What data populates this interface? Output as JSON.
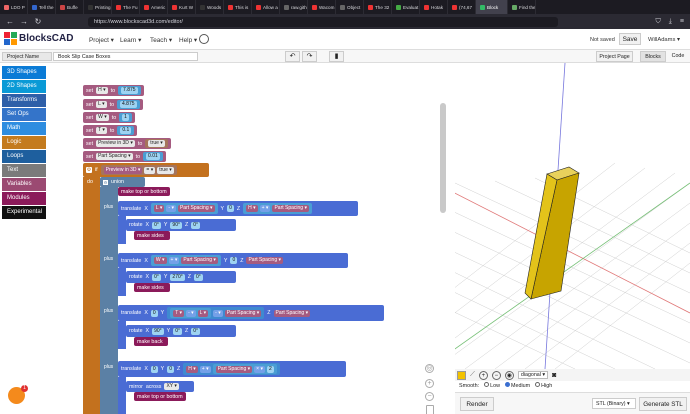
{
  "browser": {
    "tabs": [
      {
        "label": "LDO P",
        "color": "#e66"
      },
      {
        "label": "Tell the",
        "color": "#36c"
      },
      {
        "label": "Buffe",
        "color": "#c44"
      },
      {
        "label": "Printing",
        "color": "#333"
      },
      {
        "label": "The Fu",
        "color": "#e33"
      },
      {
        "label": "Americ",
        "color": "#e33"
      },
      {
        "label": "Kurt W",
        "color": "#e33"
      },
      {
        "label": "Woods",
        "color": "#333"
      },
      {
        "label": "This is",
        "color": "#e33"
      },
      {
        "label": "Allow a",
        "color": "#e33"
      },
      {
        "label": "raw.githubus",
        "color": "#666"
      },
      {
        "label": "Wacom",
        "color": "#e33"
      },
      {
        "label": "Object",
        "color": "#666"
      },
      {
        "label": "The 32",
        "color": "#e33"
      },
      {
        "label": "Evaluat",
        "color": "#4a4"
      },
      {
        "label": "Hotak",
        "color": "#e33"
      },
      {
        "label": "(74,67",
        "color": "#e33"
      },
      {
        "label": "Block",
        "color": "#3b6"
      },
      {
        "label": "Find the",
        "color": "#6a6"
      }
    ],
    "url": "https://www.blockscad3d.com/editor/",
    "nav_back": "←",
    "nav_forward": "→",
    "nav_reload": "↻"
  },
  "app": {
    "logo": "BlocksCAD",
    "menus": [
      "Project",
      "Learn",
      "Teach",
      "Help"
    ],
    "status": "Not saved",
    "save_label": "Save",
    "user": "WillAdams"
  },
  "project": {
    "name_label": "Project Name",
    "name_value": "Book Slip Case Boxes",
    "project_page": "Project Page",
    "blocks": "Blocks",
    "code": "Code"
  },
  "toolbox": [
    {
      "label": "3D Shapes",
      "color": "#0a7bd6"
    },
    {
      "label": "2D Shapes",
      "color": "#0a9ad6"
    },
    {
      "label": "Transforms",
      "color": "#2e5fa8"
    },
    {
      "label": "Set Ops",
      "color": "#3474c9"
    },
    {
      "label": "Math",
      "color": "#2e8de0"
    },
    {
      "label": "Logic",
      "color": "#c47b1e"
    },
    {
      "label": "Loops",
      "color": "#1e5f9e"
    },
    {
      "label": "Text",
      "color": "#7b7b7b"
    },
    {
      "label": "Variables",
      "color": "#9b4a72"
    },
    {
      "label": "Modules",
      "color": "#8b1a5a"
    },
    {
      "label": "Experimental",
      "color": "#111111"
    }
  ],
  "blocks": {
    "set_vars": [
      {
        "kw": "set",
        "var": "H",
        "to": "to",
        "val": "7.875"
      },
      {
        "kw": "set",
        "var": "L",
        "to": "to",
        "val": "4.875"
      },
      {
        "kw": "set",
        "var": "W",
        "to": "to",
        "val": "1"
      },
      {
        "kw": "set",
        "var": "T",
        "to": "to",
        "val": "0.1"
      },
      {
        "kw": "set",
        "var": "Preview in 3D",
        "to": "to",
        "val": "true"
      },
      {
        "kw": "set",
        "var": "Part Spacing",
        "to": "to",
        "val": "0.01"
      }
    ],
    "if_kw": "if",
    "do_kw": "do",
    "cond_var": "Preview in 3D",
    "cond_op": "=",
    "cond_val": "true",
    "union": "union",
    "plus": "plus",
    "make_top": "make top or bottom",
    "make_sides": "make sides",
    "make_back": "make back",
    "translate": "translate",
    "rotate": "rotate",
    "mirror": "mirror",
    "across": "across",
    "mirror_plane": "XY",
    "x": "X",
    "y": "Y",
    "z": "Z",
    "zero": "0",
    "minus": "-",
    "plus_op": "+",
    "times": "×",
    "H": "H",
    "L": "L",
    "W": "W",
    "T": "T",
    "part_spacing": "Part Spacing",
    "ninety": "90",
    "two_seventy": "270",
    "two": "2"
  },
  "viewer": {
    "view_option": "diagonal",
    "smooth_label": "Smooth:",
    "smooth_options": [
      "Low",
      "Medium",
      "High"
    ],
    "smooth_selected": "Medium",
    "render": "Render",
    "export_format": "STL (Binary)",
    "generate": "Generate STL",
    "object_color": "#f2c200"
  },
  "help_badge": "1"
}
